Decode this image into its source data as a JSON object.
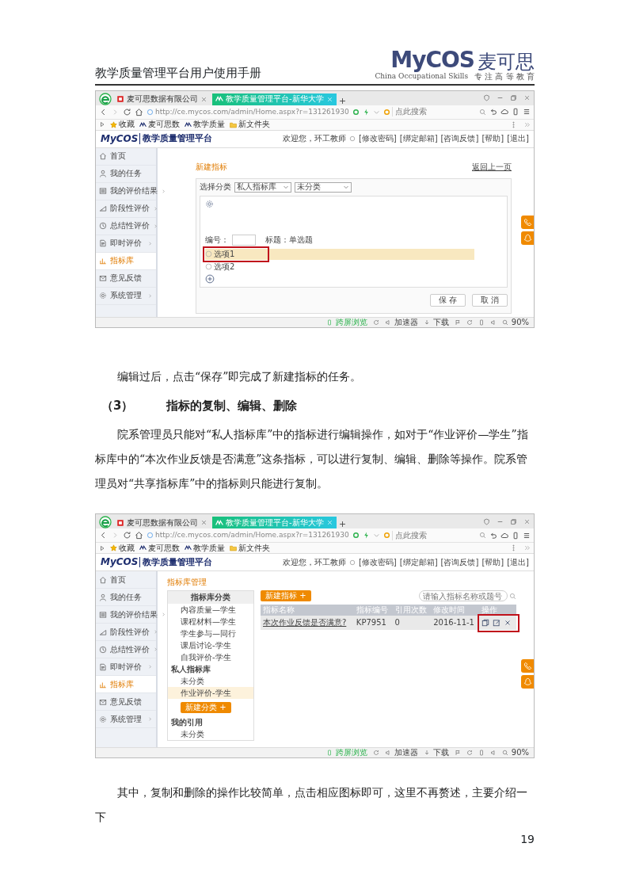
{
  "header": {
    "title": "教学质量管理平台用户使用手册",
    "logo": {
      "brand": "MyCOS",
      "name": "麦可思",
      "tagline": "China Occupational Skills",
      "slogan": "专 注 高 等 教 育"
    }
  },
  "body": [
    {
      "kind": "figure",
      "screenshot": {
        "tabs": [
          {
            "label": "麦可思数据有限公司",
            "selected": false
          },
          {
            "label": "教学质量管理平台-新华大学",
            "selected": true
          }
        ],
        "address": "http://ce.mycos.com/admin/Home.aspx?r=131261930",
        "search_placeholder": "点此搜索",
        "bookmarks": [
          "收藏",
          "麦可思数",
          "教学质量",
          "新文件夹"
        ],
        "app": {
          "logo": "MyCOS",
          "title": "教学质量管理平台",
          "welcome": "欢迎您，环工教师",
          "links": [
            "[修改密码]",
            "[绑定邮箱]",
            "[咨询反馈]",
            "[帮助]",
            "[退出]"
          ]
        },
        "sidebar": [
          {
            "label": "首页",
            "selected": false,
            "submenu": false
          },
          {
            "label": "我的任务",
            "selected": false,
            "submenu": false
          },
          {
            "label": "我的评价结果",
            "selected": false,
            "submenu": true
          },
          {
            "label": "阶段性评价",
            "selected": false,
            "submenu": true
          },
          {
            "label": "总结性评价",
            "selected": false,
            "submenu": true
          },
          {
            "label": "即时评价",
            "selected": false,
            "submenu": true
          },
          {
            "label": "指标库",
            "selected": true,
            "submenu": false
          },
          {
            "label": "意见反馈",
            "selected": false,
            "submenu": false
          },
          {
            "label": "系统管理",
            "selected": false,
            "submenu": true
          }
        ],
        "content": {
          "kind": "new_indicator",
          "title": "新建指标",
          "back_link": "返回上一页",
          "category_label": "选择分类",
          "category_selects": [
            "私人指标库",
            "未分类"
          ],
          "number_label": "编号：",
          "question_title": "标题：单选题",
          "options": [
            {
              "label": "选项1",
              "checked": false,
              "highlighted": true,
              "framed": true
            },
            {
              "label": "选项2",
              "checked": false,
              "highlighted": false,
              "framed": false
            }
          ],
          "buttons": [
            "保 存",
            "取 消"
          ]
        },
        "status": {
          "items": [
            "跨屏浏览",
            "加速器",
            "下载"
          ],
          "zoom": "90%"
        }
      }
    },
    {
      "kind": "paragraph",
      "text": "编辑过后，点击“保存”即完成了新建指标的任务。"
    },
    {
      "kind": "heading",
      "number": "（3）",
      "text": "指标的复制、编辑、删除"
    },
    {
      "kind": "paragraph",
      "text": "院系管理员只能对“私人指标库”中的指标进行编辑操作，如对于“作业评价—学生”指标库中的“本次作业反馈是否满意”这条指标，可以进行复制、编辑、删除等操作。院系管理员对“共享指标库”中的指标则只能进行复制。"
    },
    {
      "kind": "figure",
      "screenshot": {
        "tabs": [
          {
            "label": "麦可思数据有限公司",
            "selected": false
          },
          {
            "label": "教学质量管理平台-新华大学",
            "selected": true
          }
        ],
        "address": "http://ce.mycos.com/admin/Home.aspx?r=131261930",
        "search_placeholder": "点此搜索",
        "bookmarks": [
          "收藏",
          "麦可思数",
          "教学质量",
          "新文件夹"
        ],
        "app": {
          "logo": "MyCOS",
          "title": "教学质量管理平台",
          "welcome": "欢迎您，环工教师",
          "links": [
            "[修改密码]",
            "[绑定邮箱]",
            "[咨询反馈]",
            "[帮助]",
            "[退出]"
          ]
        },
        "sidebar": [
          {
            "label": "首页",
            "selected": false,
            "submenu": false
          },
          {
            "label": "我的任务",
            "selected": false,
            "submenu": false
          },
          {
            "label": "我的评价结果",
            "selected": false,
            "submenu": true
          },
          {
            "label": "阶段性评价",
            "selected": false,
            "submenu": true
          },
          {
            "label": "总结性评价",
            "selected": false,
            "submenu": true
          },
          {
            "label": "即时评价",
            "selected": false,
            "submenu": true
          },
          {
            "label": "指标库",
            "selected": true,
            "submenu": false
          },
          {
            "label": "意见反馈",
            "selected": false,
            "submenu": false
          },
          {
            "label": "系统管理",
            "selected": false,
            "submenu": true
          }
        ],
        "content": {
          "kind": "library",
          "title": "指标库管理",
          "panel_title": "指标库分类",
          "category_groups": [
            {
              "items": [
                {
                  "label": "内容质量—学生",
                  "selected": false
                },
                {
                  "label": "课程材料—学生",
                  "selected": false
                },
                {
                  "label": "学生参与—同行",
                  "selected": false
                },
                {
                  "label": "课后讨论-学生",
                  "selected": false
                },
                {
                  "label": "自我评价-学生",
                  "selected": false
                }
              ]
            },
            {
              "name": "私人指标库",
              "items": [
                {
                  "label": "未分类",
                  "selected": false
                },
                {
                  "label": "作业评价-学生",
                  "selected": true
                }
              ],
              "add_button": "新建分类 +"
            },
            {
              "name": "我的引用",
              "items": [
                {
                  "label": "未分类",
                  "selected": false
                }
              ]
            }
          ],
          "new_button": "新建指标 +",
          "search_placeholder": "请输入指标名称或题号",
          "columns": [
            "指标名称",
            "指标编号",
            "引用次数",
            "修改时间",
            "操作"
          ],
          "rows": [
            {
              "cells": [
                "本次作业反馈是否满意?",
                "KP7951",
                "0",
                "2016-11-1"
              ],
              "actions_framed": true
            }
          ]
        },
        "status": {
          "items": [
            "跨屏浏览",
            "加速器",
            "下载"
          ],
          "zoom": "90%"
        }
      }
    },
    {
      "kind": "paragraph",
      "text": "其中，复制和删除的操作比较简单，点击相应图标即可，这里不再赘述，主要介绍一下"
    }
  ],
  "page_number": "19"
}
